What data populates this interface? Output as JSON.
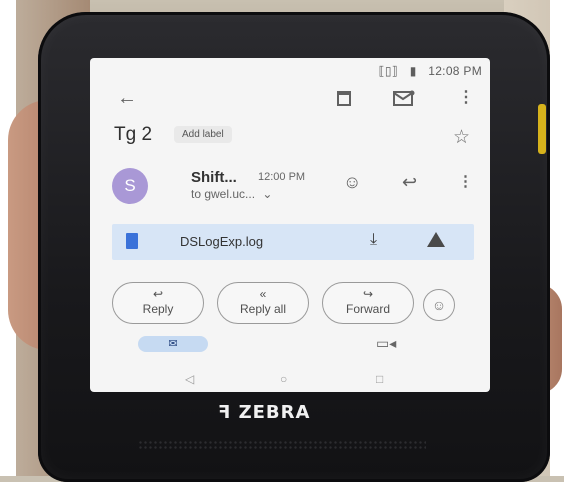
{
  "status_bar": {
    "vibrate_icon": "vibrate-icon",
    "battery_icon": "battery-icon",
    "time": "12:08 PM"
  },
  "toolbar": {
    "back_icon": "arrow-back-icon",
    "delete_icon": "trash-icon",
    "unread_icon": "mail-unread-icon",
    "more_icon": "more-vert-icon"
  },
  "email": {
    "subject": "Tg 2",
    "label_chip": "Add label",
    "star_icon": "star-outline-icon",
    "avatar_letter": "S",
    "avatar_color": "#a998d6",
    "sender": "Shift...",
    "time": "12:00 PM",
    "to": "to gwel.uc...",
    "emoji_icon": "smiley-icon",
    "reply_icon": "reply-icon",
    "more_icon": "more-vert-icon"
  },
  "attachment": {
    "file_icon": "file-icon",
    "name": "DSLogExp.log",
    "download_icon": "download-icon",
    "drive_icon": "drive-icon",
    "bg_color": "#d7e5f6"
  },
  "actions": {
    "reply": "Reply",
    "reply_all": "Reply all",
    "forward": "Forward",
    "emoji_icon": "smiley-icon"
  },
  "bottom_nav": {
    "mail_icon": "mail-icon",
    "meet_icon": "video-icon"
  },
  "system_nav": {
    "back": "◁",
    "home": "○",
    "recents": "□"
  },
  "device": {
    "brand": "ZEBRA",
    "accent": "#d6b21c"
  }
}
